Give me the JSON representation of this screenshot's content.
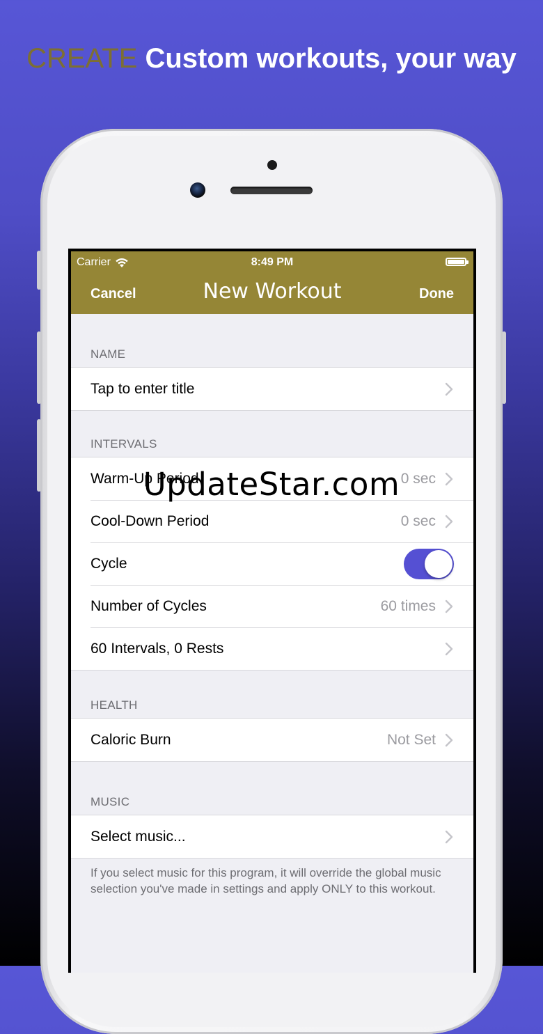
{
  "headline": {
    "accent": "CREATE",
    "text": "Custom workouts, your way"
  },
  "status_bar": {
    "carrier": "Carrier",
    "time": "8:49 PM"
  },
  "nav": {
    "cancel": "Cancel",
    "title": "New Workout",
    "done": "Done"
  },
  "sections": {
    "name": {
      "header": "NAME",
      "rows": [
        {
          "label": "Tap to enter title"
        }
      ]
    },
    "intervals": {
      "header": "INTERVALS",
      "rows": [
        {
          "label": "Warm-Up Period",
          "value": "0 sec"
        },
        {
          "label": "Cool-Down Period",
          "value": "0 sec"
        },
        {
          "label": "Cycle",
          "toggle": true
        },
        {
          "label": "Number of Cycles",
          "value": "60 times"
        },
        {
          "label": "60 Intervals, 0 Rests"
        }
      ]
    },
    "health": {
      "header": "HEALTH",
      "rows": [
        {
          "label": "Caloric Burn",
          "value": "Not Set"
        }
      ]
    },
    "music": {
      "header": "MUSIC",
      "rows": [
        {
          "label": "Select music..."
        }
      ],
      "footer": "If you select music for this program, it will override the global music selection you've made in settings and apply ONLY to this workout."
    }
  },
  "watermark": "UpdateStar.com",
  "colors": {
    "background_top": "#5756d6",
    "nav_bar": "#958636",
    "accent_text": "#7d6f32",
    "toggle_on": "#5550d3",
    "group_bg": "#efeff4"
  }
}
